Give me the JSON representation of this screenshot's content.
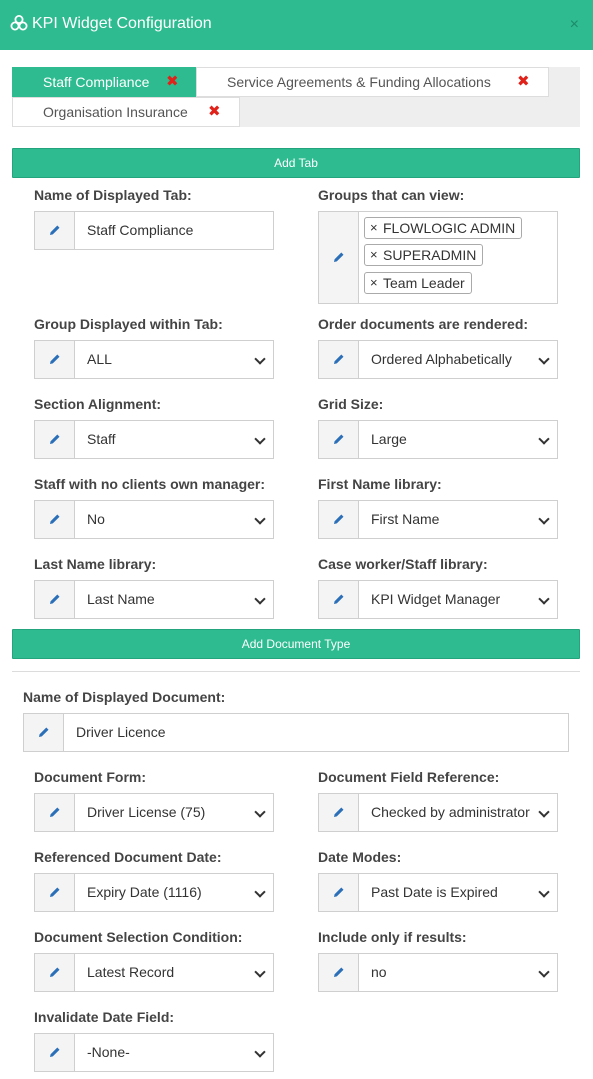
{
  "header": {
    "title": "KPI Widget Configuration",
    "close": "×"
  },
  "tabs": [
    {
      "label": "Staff Compliance",
      "remove": "✖"
    },
    {
      "label": "Service Agreements & Funding Allocations",
      "remove": "✖"
    },
    {
      "label": "Organisation Insurance",
      "remove": "✖"
    }
  ],
  "add_tab_label": "Add Tab",
  "tab_settings": {
    "name_label": "Name of Displayed Tab:",
    "name_value": "Staff Compliance",
    "groups_label": "Groups that can view:",
    "groups": [
      "FLOWLOGIC ADMIN",
      "SUPERADMIN",
      "Team Leader"
    ],
    "tag_remove": "×",
    "group_within_label": "Group Displayed within Tab:",
    "group_within_value": "ALL",
    "order_label": "Order documents are rendered:",
    "order_value": "Ordered Alphabetically",
    "section_alignment_label": "Section Alignment:",
    "section_alignment_value": "Staff",
    "grid_size_label": "Grid Size:",
    "grid_size_value": "Large",
    "staff_no_clients_label": "Staff with no clients own manager:",
    "staff_no_clients_value": "No",
    "first_name_label": "First Name library:",
    "first_name_value": "First Name",
    "last_name_label": "Last Name library:",
    "last_name_value": "Last Name",
    "caseworker_label": "Case worker/Staff library:",
    "caseworker_value": "KPI Widget Manager"
  },
  "add_document_label": "Add Document Type",
  "document": {
    "name_label": "Name of Displayed Document:",
    "name_value": "Driver Licence",
    "form_label": "Document Form:",
    "form_value": "Driver License (75)",
    "field_ref_label": "Document Field Reference:",
    "field_ref_value": "Checked by administrator",
    "ref_date_label": "Referenced Document Date:",
    "ref_date_value": "Expiry Date (1116)",
    "date_modes_label": "Date Modes:",
    "date_modes_value": "Past Date is Expired",
    "selection_label": "Document Selection Condition:",
    "selection_value": "Latest Record",
    "include_label": "Include only if results:",
    "include_value": "no",
    "invalidate_label": "Invalidate Date Field:",
    "invalidate_value": "-None-"
  }
}
